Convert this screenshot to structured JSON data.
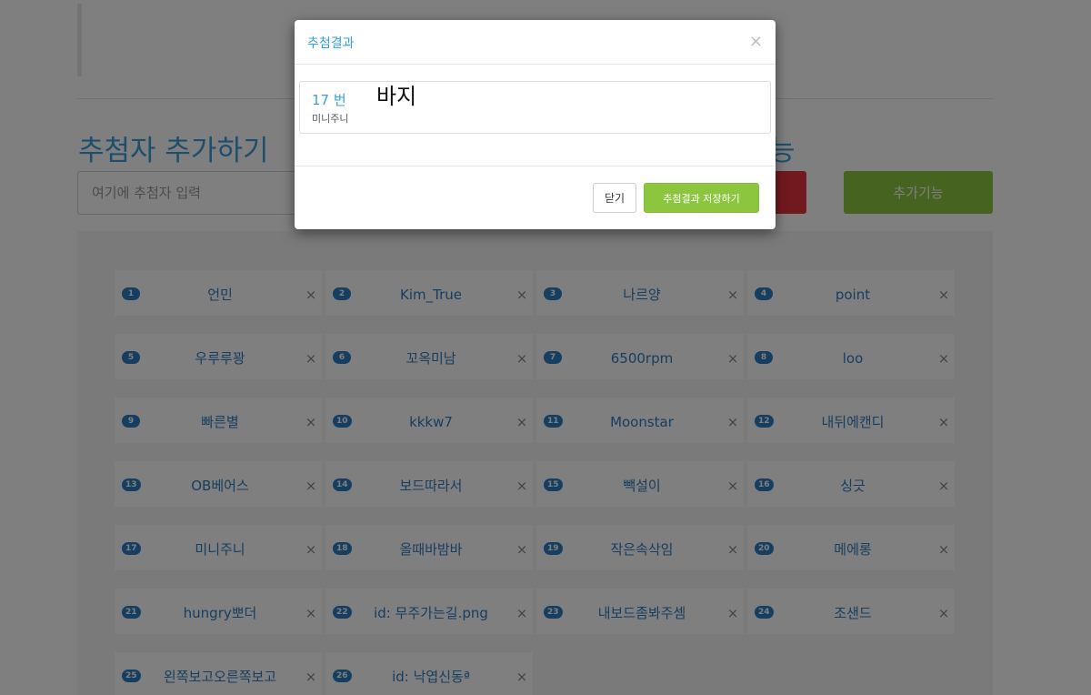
{
  "page": {
    "section_title": "추첨자 추가하기",
    "section_title_2": "능",
    "input_placeholder": "여기에 추첨자 입력",
    "add_function_label": "추가기능"
  },
  "entries": [
    {
      "num": "1",
      "name": "언민"
    },
    {
      "num": "2",
      "name": "Kim_True"
    },
    {
      "num": "3",
      "name": "나르양"
    },
    {
      "num": "4",
      "name": "point"
    },
    {
      "num": "5",
      "name": "우루루꽝"
    },
    {
      "num": "6",
      "name": "꼬옥미남"
    },
    {
      "num": "7",
      "name": "6500rpm"
    },
    {
      "num": "8",
      "name": "loo"
    },
    {
      "num": "9",
      "name": "빠른별"
    },
    {
      "num": "10",
      "name": "kkkw7"
    },
    {
      "num": "11",
      "name": "Moonstar"
    },
    {
      "num": "12",
      "name": "내뒤에캔디"
    },
    {
      "num": "13",
      "name": "OB베어스"
    },
    {
      "num": "14",
      "name": "보드따라서"
    },
    {
      "num": "15",
      "name": "빽설이"
    },
    {
      "num": "16",
      "name": "싱긋"
    },
    {
      "num": "17",
      "name": "미니주니"
    },
    {
      "num": "18",
      "name": "올때바밤바"
    },
    {
      "num": "19",
      "name": "작은속삭임"
    },
    {
      "num": "20",
      "name": "메에롱"
    },
    {
      "num": "21",
      "name": "hungry뽀더"
    },
    {
      "num": "22",
      "name": "id: 무주가는길.png"
    },
    {
      "num": "23",
      "name": "내보드좀봐주셈"
    },
    {
      "num": "24",
      "name": "조샌드"
    },
    {
      "num": "25",
      "name": "왼쪽보고오른쪽보고"
    },
    {
      "num": "26",
      "name": "id: 낙엽신동ª"
    }
  ],
  "entry_close_glyph": "×",
  "modal": {
    "title": "추첨결과",
    "close_glyph": "×",
    "result_number": "17 번",
    "result_name": "미니주니",
    "result_prize": "바지",
    "close_button_label": "닫기",
    "save_button_label": "추첨결과 저장하기"
  },
  "colors": {
    "accent_blue": "#3a9fd8",
    "badge_blue": "#2c7cc1",
    "green": "#8cc63f",
    "red": "#e5323e"
  }
}
